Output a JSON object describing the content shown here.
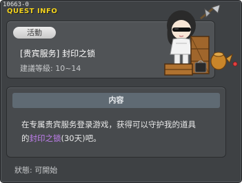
{
  "window": {
    "quest_id": "10663-0",
    "title": "QUEST INFO"
  },
  "info": {
    "badge": "活動",
    "quest_name": "[贵宾服务] 封印之锁",
    "level": "建議等級: 10~14"
  },
  "content": {
    "header": "内容",
    "text_line1": "在专属贵宾服务登录游戏，获得可以守护我的道具",
    "text_line2_prefix": "的",
    "text_line2_highlight": "封印之锁",
    "text_line2_suffix": "(30天)吧。"
  },
  "status": "狀態: 可開始",
  "colors": {
    "title": "#f2d21c",
    "highlight": "#c27ff0",
    "window_bg": "#3e4144"
  }
}
